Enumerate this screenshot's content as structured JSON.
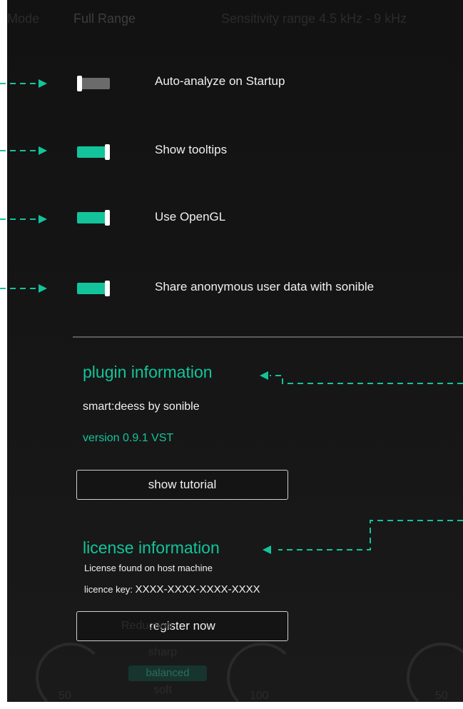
{
  "background": {
    "mode_label": "Mode",
    "mode_value": "Full Range",
    "header_faint": "Sensitivity range  4.5 kHz - 9 kHz",
    "sharp": "sharp",
    "balanced": "balanced",
    "soft": "soft",
    "knob_left_value": "50",
    "knob_center_value": "100",
    "knob_right_value": "50",
    "reduction_label": "Reduction"
  },
  "settings": {
    "items": [
      {
        "label": "Auto-analyze on Startup",
        "state": "off"
      },
      {
        "label": "Show tooltips",
        "state": "on"
      },
      {
        "label": "Use OpenGL",
        "state": "on"
      },
      {
        "label": "Share anonymous user data with sonible",
        "state": "on"
      }
    ]
  },
  "plugin_info": {
    "title": "plugin information",
    "product": "smart:deess by sonible",
    "version": "version 0.9.1 VST",
    "tutorial_button": "show tutorial"
  },
  "license_info": {
    "title": "license information",
    "status": "License found on host machine",
    "key_label": "licence key: ",
    "key_value": "XXXX-XXXX-XXXX-XXXX",
    "register_button": "register now"
  },
  "colors": {
    "accent": "#13c49a",
    "panel_bg": "#141414",
    "toggle_off": "#6b6b6b",
    "text": "#f0f0f0"
  }
}
